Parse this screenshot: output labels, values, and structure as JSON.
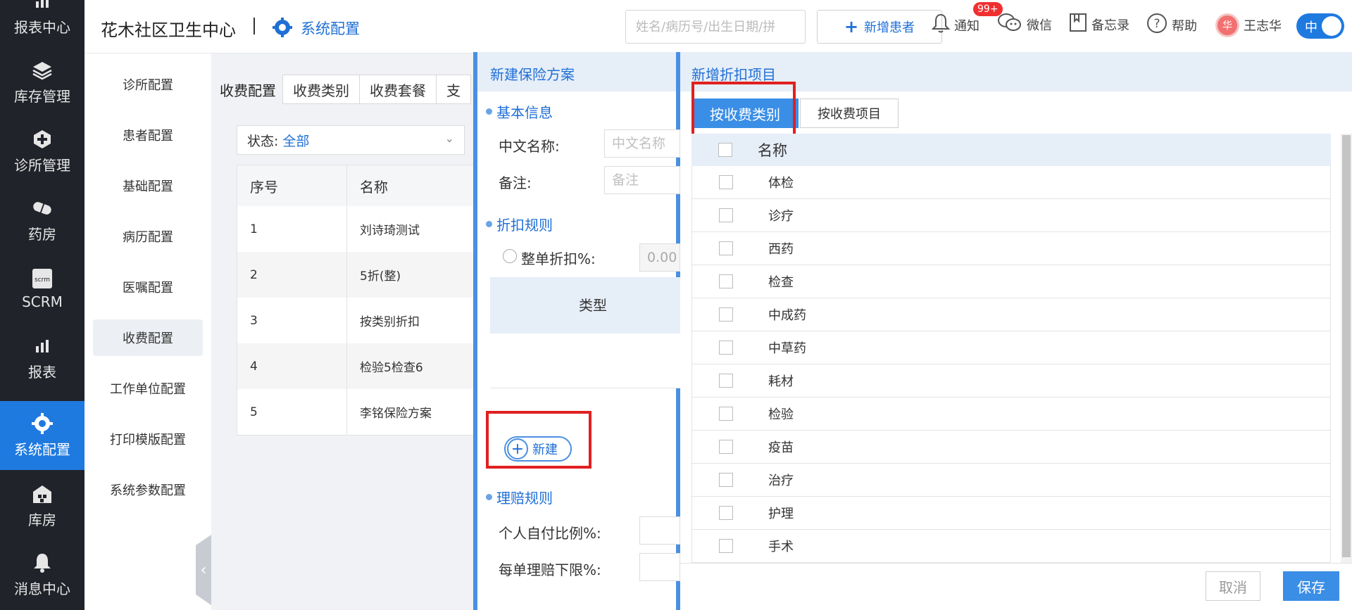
{
  "leftnav": {
    "items": [
      {
        "label": "报表中心",
        "icon": "chart-bar-icon"
      },
      {
        "label": "库存管理",
        "icon": "layers-icon"
      },
      {
        "label": "诊所管理",
        "icon": "medical-plus-icon"
      },
      {
        "label": "药房",
        "icon": "pill-icon"
      },
      {
        "label": "SCRM",
        "icon": "scrm-icon"
      },
      {
        "label": "报表",
        "icon": "chart-bar-icon"
      },
      {
        "label": "系统配置",
        "icon": "gear-icon"
      },
      {
        "label": "库房",
        "icon": "warehouse-icon"
      },
      {
        "label": "消息中心",
        "icon": "bell-icon"
      }
    ],
    "active_index": 6
  },
  "header": {
    "clinic_name": "花木社区卫生中心",
    "crumb": "系统配置",
    "search_placeholder": "姓名/病历号/出生日期/拼",
    "new_patient": "新增患者",
    "notify": "通知",
    "notify_badge": "99+",
    "wechat": "微信",
    "memo": "备忘录",
    "help": "帮助",
    "user": "王志华",
    "avatar_char": "华",
    "lang": "中"
  },
  "subnav": {
    "items": [
      "诊所配置",
      "患者配置",
      "基础配置",
      "病历配置",
      "医嘱配置",
      "收费配置",
      "工作单位配置",
      "打印模版配置",
      "系统参数配置"
    ],
    "active_index": 5
  },
  "fee_page": {
    "title": "收费配置",
    "tabs": [
      "收费类别",
      "收费套餐",
      "支"
    ],
    "status_label": "状态:",
    "status_value": "全部",
    "columns": [
      "序号",
      "名称"
    ],
    "rows": [
      [
        "1",
        "刘诗琦测试"
      ],
      [
        "2",
        "5折(整)"
      ],
      [
        "3",
        "按类别折扣"
      ],
      [
        "4",
        "检验5检查6"
      ],
      [
        "5",
        "李铭保险方案"
      ]
    ]
  },
  "plan_panel": {
    "title": "新建保险方案",
    "basic_info": "基本信息",
    "cn_name_label": "中文名称:",
    "cn_name_placeholder": "中文名称",
    "remark_label": "备注:",
    "remark_placeholder": "备注",
    "discount_rules": "折扣规则",
    "whole_discount_label": "整单折扣%:",
    "whole_discount_value": "0.00",
    "type_col": "类型",
    "new_button": "新建",
    "claim_rules": "理赔规则",
    "self_pay_label": "个人自付比例%:",
    "claim_min_label": "每单理赔下限%:"
  },
  "discount_panel": {
    "title": "新增折扣项目",
    "by_category": "按收费类别",
    "by_item": "按收费项目",
    "name_header": "名称",
    "items": [
      "体检",
      "诊疗",
      "西药",
      "检查",
      "中成药",
      "中草药",
      "耗材",
      "检验",
      "疫苗",
      "治疗",
      "护理",
      "手术"
    ],
    "cancel": "取消",
    "save": "保存"
  },
  "colors": {
    "nav_bg": "#20232a",
    "accent": "#1f7ae0",
    "panel_header": "#e6eef8",
    "highlight": "#e02020"
  }
}
